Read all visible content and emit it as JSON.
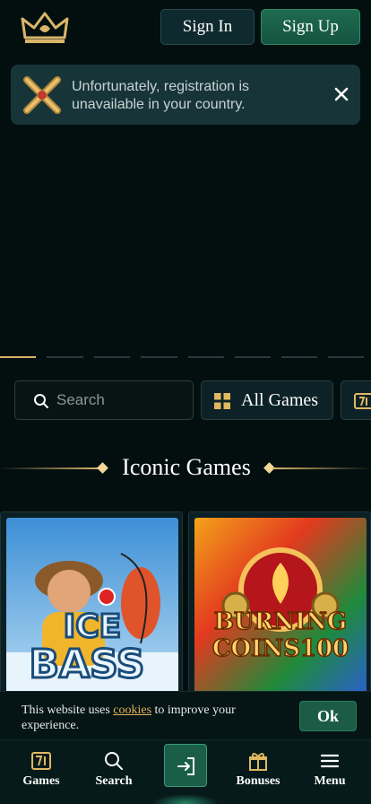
{
  "header": {
    "logo_icon": "crown-logo",
    "signin_label": "Sign In",
    "signup_label": "Sign Up"
  },
  "notice": {
    "icon": "x-mark-icon",
    "text": "Unfortunately, registration is unavailable in your country.",
    "close_icon": "close-icon"
  },
  "carousel": {
    "slides_total": 8,
    "active_index": 0
  },
  "search": {
    "icon": "search-icon",
    "placeholder": "Search",
    "value": ""
  },
  "categories": {
    "active_label": "All Games",
    "active_icon": "grid-icon",
    "next_icon": "slot-777-icon"
  },
  "section": {
    "title": "Iconic Games"
  },
  "games": [
    {
      "name": "Ice Bass",
      "art_lines": [
        "ICE",
        "BASS"
      ]
    },
    {
      "name": "Burning Coins 100",
      "art_lines": [
        "BURNING",
        "COINS100"
      ]
    }
  ],
  "cookie": {
    "text_before": "This website uses ",
    "link_text": "cookies",
    "text_after": " to improve your experience.",
    "ok_label": "Ok"
  },
  "nav": {
    "games_label": "Games",
    "search_label": "Search",
    "login_icon": "login-icon",
    "bonuses_label": "Bonuses",
    "menu_label": "Menu"
  },
  "colors": {
    "background": "#030f0f",
    "accent_gold": "#d9b56a",
    "primary_green": "#1f6b50",
    "link": "#e1b25a"
  }
}
